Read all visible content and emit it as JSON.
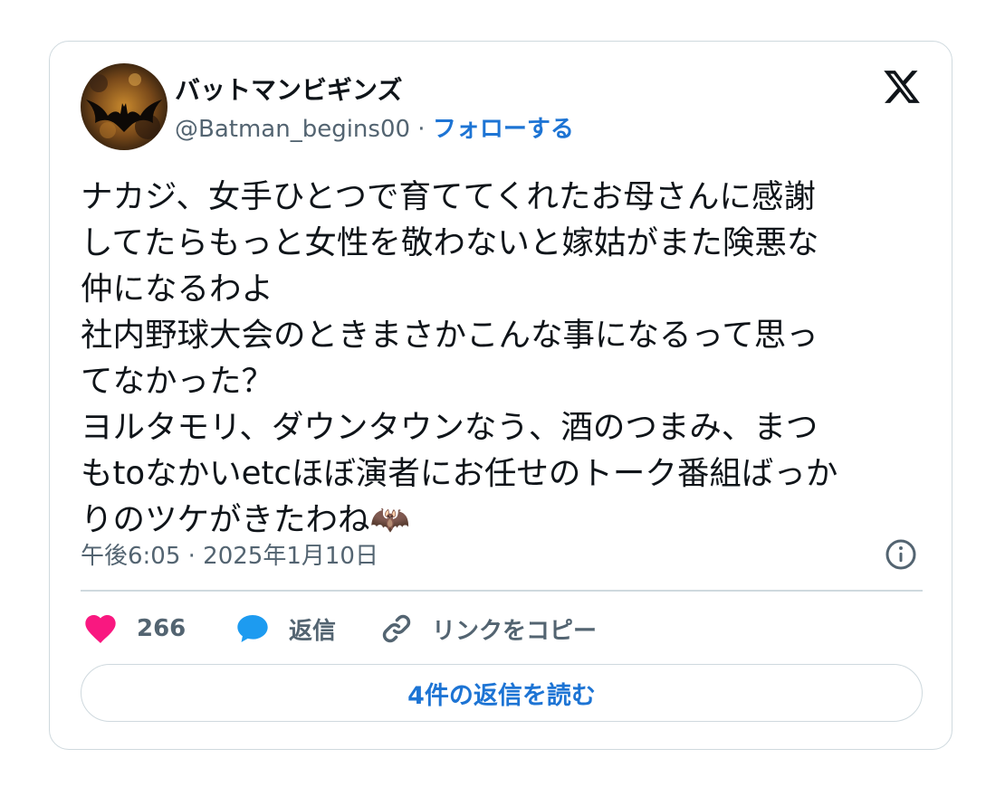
{
  "user": {
    "display_name": "バットマンビギンズ",
    "handle": "@Batman_begins00",
    "separator": " · ",
    "follow_label": "フォローする"
  },
  "tweet": {
    "lines": [
      "ナカジ、女手ひとつで育ててくれたお母さんに感謝",
      "してたらもっと女性を敬わないと嫁姑がまた険悪な",
      "仲になるわよ",
      "社内野球大会のときまさかこんな事になるって思っ",
      "てなかった？",
      "ヨルタモリ、ダウンタウンなう、酒のつまみ、まつ",
      "もtoなかいetcほぼ演者にお任せのトーク番組ばっか",
      "りのツケがきたわね🦇"
    ],
    "timestamp": "午後6:05 · 2025年1月10日"
  },
  "actions": {
    "like_count": "266",
    "reply_label": "返信",
    "copy_link_label": "リンクをコピー"
  },
  "read_replies_label": "4件の返信を読む",
  "icons": {
    "logo": "x-logo-icon",
    "info": "info-icon",
    "like": "heart-icon",
    "reply": "speech-bubble-icon",
    "copy": "link-icon"
  },
  "colors": {
    "accent": "#1d74d4",
    "like": "#f91880",
    "reply": "#1d9bf0",
    "secondary_text": "#536471",
    "border": "#cfd9de"
  }
}
